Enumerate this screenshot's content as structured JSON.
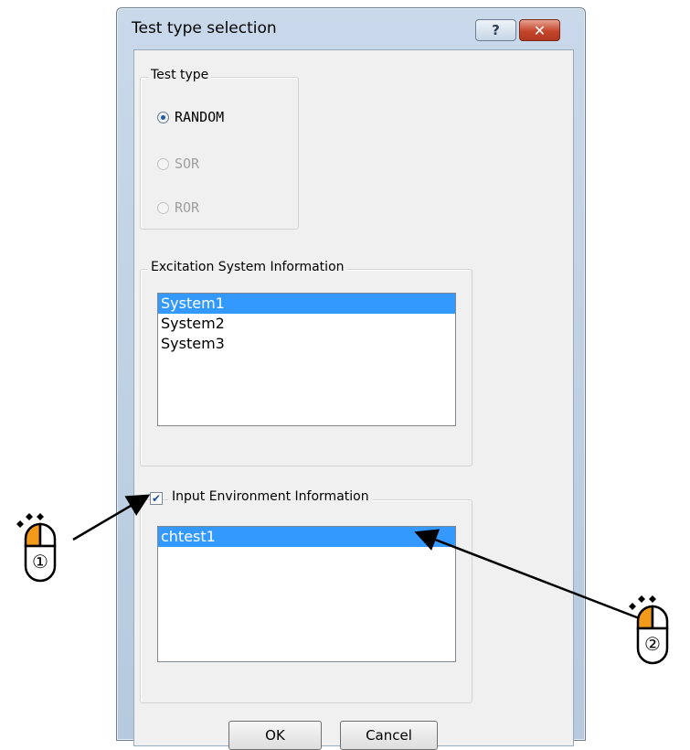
{
  "dialog": {
    "title": "Test type selection",
    "help_glyph": "?",
    "close_glyph": "✕"
  },
  "test_type": {
    "legend": "Test type",
    "options": [
      {
        "label": "RANDOM",
        "checked": true,
        "enabled": true
      },
      {
        "label": "SOR",
        "checked": false,
        "enabled": false
      },
      {
        "label": "ROR",
        "checked": false,
        "enabled": false
      }
    ]
  },
  "excitation": {
    "legend": "Excitation System Information",
    "items": [
      "System1",
      "System2",
      "System3"
    ],
    "selected_index": 0
  },
  "input_env": {
    "label": "Input Environment Information",
    "checked": true,
    "items": [
      "chtest1"
    ],
    "selected_index": 0
  },
  "buttons": {
    "ok": "OK",
    "cancel": "Cancel"
  },
  "callouts": [
    {
      "number": "①",
      "icon": "mouse-left-click-icon"
    },
    {
      "number": "②",
      "icon": "mouse-left-click-icon"
    }
  ],
  "colors": {
    "selection": "#3399ff",
    "mouse_button": "#f39a1b",
    "arrow": "#000000"
  }
}
